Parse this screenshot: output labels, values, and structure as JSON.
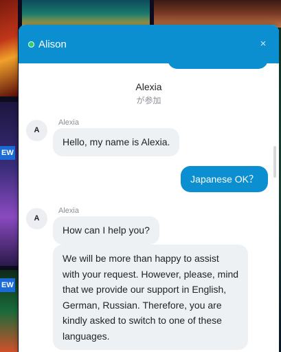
{
  "background": {
    "badges": [
      "EW",
      "EW"
    ]
  },
  "chat": {
    "header": {
      "agent_name": "Alison",
      "status_color": "#2ed15f",
      "close_icon": "×"
    },
    "join_notice": {
      "name": "Alexia",
      "text": "が参加"
    },
    "messages": [
      {
        "from": "agent",
        "avatar": "A",
        "sender": "Alexia",
        "text": "Hello, my name is Alexia."
      },
      {
        "from": "user",
        "text": "Japanese OK？"
      },
      {
        "from": "agent",
        "avatar": "A",
        "sender": "Alexia",
        "text": "How can I help you?"
      },
      {
        "from": "agent",
        "text": "We will be more than happy to assist with your request. However, please, mind that we provide our support in English, German, Russian. Therefore, you are kindly asked to switch to one of these languages."
      }
    ],
    "colors": {
      "accent": "#0c8fd0",
      "incoming_bubble": "#eef1f4"
    }
  }
}
